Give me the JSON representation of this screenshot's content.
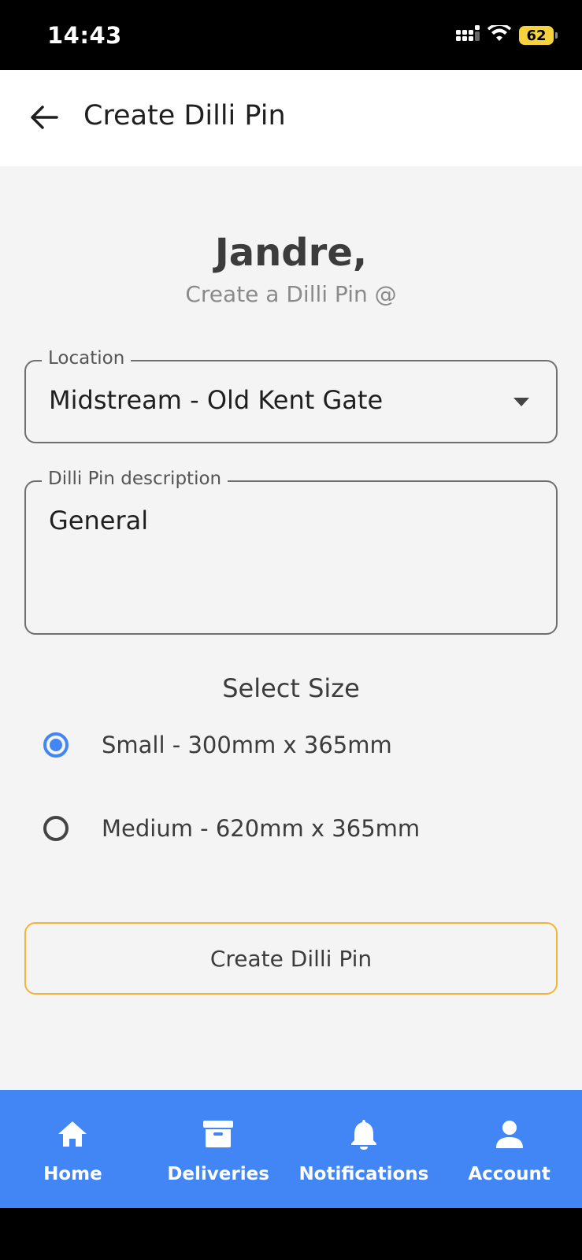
{
  "status_bar": {
    "time": "14:43",
    "battery": "62"
  },
  "app_bar": {
    "title": "Create Dilli Pin",
    "back_icon": "arrow-left-icon"
  },
  "greeting": {
    "name": "Jandre,",
    "subtitle": "Create a Dilli Pin @"
  },
  "location_field": {
    "label": "Location",
    "value": "Midstream - Old Kent Gate"
  },
  "description_field": {
    "label": "Dilli Pin description",
    "value": "General"
  },
  "size_section": {
    "heading": "Select Size",
    "options": [
      {
        "label": "Small - 300mm x 365mm",
        "selected": true
      },
      {
        "label": "Medium - 620mm x 365mm",
        "selected": false
      }
    ]
  },
  "create_button": {
    "label": "Create Dilli Pin"
  },
  "bottom_nav": {
    "items": [
      {
        "label": "Home",
        "icon": "home-icon"
      },
      {
        "label": "Deliveries",
        "icon": "archive-box-icon"
      },
      {
        "label": "Notifications",
        "icon": "bell-icon"
      },
      {
        "label": "Account",
        "icon": "person-icon"
      }
    ]
  },
  "colors": {
    "primary": "#4285f4",
    "button_border": "#f3b436",
    "background": "#f4f4f4"
  }
}
